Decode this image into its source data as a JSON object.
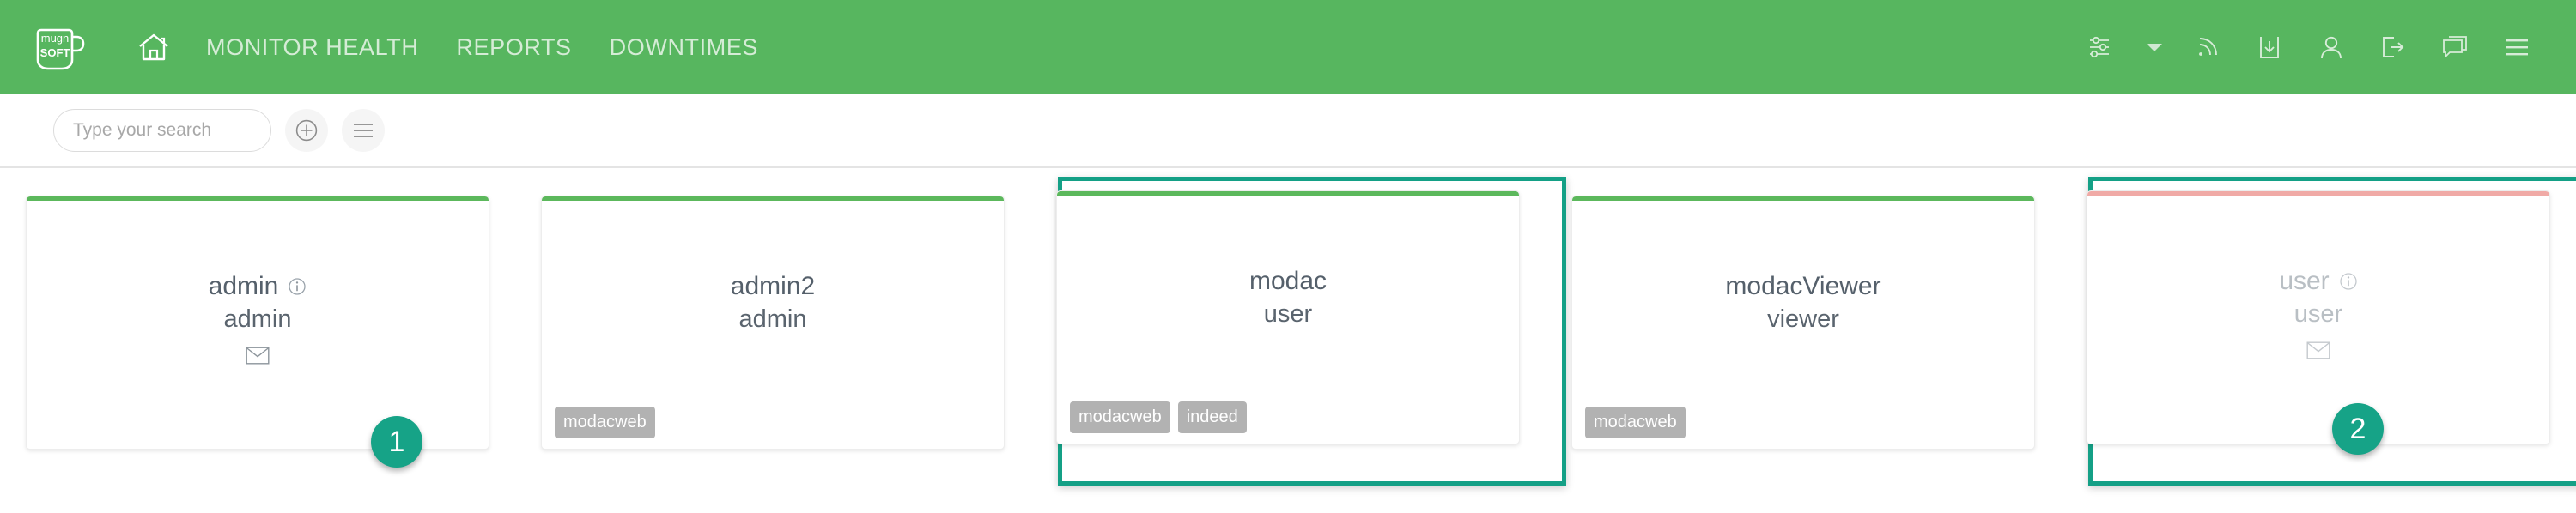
{
  "theme": {
    "header_green": "#57b65f",
    "card_active_accent": "#5cb85c",
    "card_inactive_accent": "#f0aaa6",
    "highlight_teal": "#14a086",
    "badge_teal": "#16a387",
    "tag_gray": "#b2b2b2"
  },
  "header": {
    "logo_top_text": "mugn",
    "logo_bottom_text": "SOFT",
    "home_icon": "home-icon",
    "nav": [
      {
        "label": "MONITOR HEALTH"
      },
      {
        "label": "REPORTS"
      },
      {
        "label": "DOWNTIMES"
      }
    ],
    "tools": [
      {
        "icon": "sliders-icon",
        "name": "settings-sliders-icon"
      },
      {
        "icon": "caret-down-icon",
        "name": "caret-down-icon"
      },
      {
        "icon": "rss-icon",
        "name": "rss-feed-icon"
      },
      {
        "icon": "download-icon",
        "name": "download-icon"
      },
      {
        "icon": "user-icon",
        "name": "user-account-icon"
      },
      {
        "icon": "logout-icon",
        "name": "logout-icon"
      },
      {
        "icon": "chat-icon",
        "name": "chat-icon"
      },
      {
        "icon": "hamburger-icon",
        "name": "main-menu-icon"
      }
    ]
  },
  "toolbar": {
    "search": {
      "value": "",
      "placeholder": "Type your search",
      "icon": "search-icon"
    },
    "add_button_icon": "plus-circle-icon",
    "list_button_icon": "list-lines-icon"
  },
  "cards": [
    {
      "username": "admin",
      "role": "admin",
      "has_info_icon": true,
      "has_mail_icon": true,
      "inactive": false,
      "highlighted": false,
      "badge": "",
      "tags": []
    },
    {
      "username": "admin2",
      "role": "admin",
      "has_info_icon": false,
      "has_mail_icon": false,
      "inactive": false,
      "highlighted": false,
      "badge": "",
      "tags": [
        "modacweb"
      ]
    },
    {
      "username": "modac",
      "role": "user",
      "has_info_icon": false,
      "has_mail_icon": false,
      "inactive": false,
      "highlighted": true,
      "badge": "1",
      "tags": [
        "modacweb",
        "indeed"
      ]
    },
    {
      "username": "modacViewer",
      "role": "viewer",
      "has_info_icon": false,
      "has_mail_icon": false,
      "inactive": false,
      "highlighted": false,
      "badge": "",
      "tags": [
        "modacweb"
      ]
    },
    {
      "username": "user",
      "role": "user",
      "has_info_icon": true,
      "has_mail_icon": true,
      "inactive": true,
      "highlighted": true,
      "badge": "2",
      "tags": []
    }
  ]
}
